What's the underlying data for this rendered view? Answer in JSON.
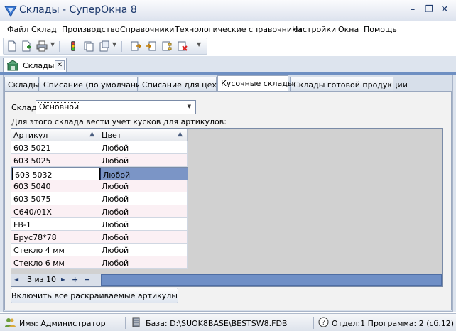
{
  "window": {
    "title": "Склады - СуперОкна 8",
    "minimize": "–",
    "restore": "❐",
    "close": "✕"
  },
  "menu": [
    "Файл",
    "Склад",
    "Производство",
    "Справочники",
    "Технологические справочники",
    "Настройки",
    "Окна",
    "Помощь"
  ],
  "document_tab": {
    "label": "Склады",
    "close": "✕"
  },
  "inner_tabs": [
    "Склады",
    "Списание (по умолчанию)",
    "Списание для цехов",
    "Кусочные склады",
    "Склады готовой продукции"
  ],
  "active_tab_index": 3,
  "form": {
    "warehouse_label": "Склад",
    "warehouse_value": "Основной",
    "note": "Для этого склада вести учет кусков для артикулов:"
  },
  "grid": {
    "columns": [
      "Артикул",
      "Цвет"
    ],
    "rows": [
      [
        "603 5021",
        "Любой"
      ],
      [
        "603 5025",
        "Любой"
      ],
      [
        "603 5032",
        "Любой"
      ],
      [
        "603 5040",
        "Любой"
      ],
      [
        "603 5075",
        "Любой"
      ],
      [
        "С640/01Х",
        "Любой"
      ],
      [
        "FB-1",
        "Любой"
      ],
      [
        "Брус78*78",
        "Любой"
      ],
      [
        "Стекло 4 мм",
        "Любой"
      ],
      [
        "Стекло 6 мм",
        "Любой"
      ]
    ],
    "selected_row": 2,
    "navigator": {
      "position": "3 из 10",
      "prev": "◄",
      "next": "►",
      "add": "+",
      "remove": "−"
    }
  },
  "button_include_all": "Включить все раскраиваемые артикулы",
  "status": {
    "user": "Имя: Администратор",
    "db": "База: D:\\SUOK8BASE\\BESTSW8.FDB",
    "info": "Отдел:1 Программа: 2 (сб.12)"
  }
}
